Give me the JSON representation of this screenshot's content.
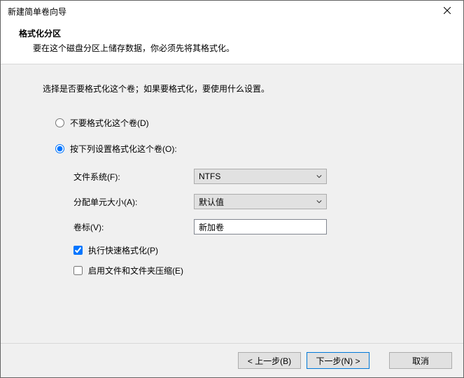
{
  "window": {
    "title": "新建简单卷向导"
  },
  "header": {
    "heading": "格式化分区",
    "description": "要在这个磁盘分区上储存数据，你必须先将其格式化。"
  },
  "body": {
    "instruction": "选择是否要格式化这个卷；如果要格式化，要使用什么设置。",
    "radio_noformat": "不要格式化这个卷(D)",
    "radio_format": "按下列设置格式化这个卷(O):",
    "fields": {
      "filesystem_label": "文件系统(F):",
      "filesystem_value": "NTFS",
      "allocation_label": "分配单元大小(A):",
      "allocation_value": "默认值",
      "volume_label": "卷标(V):",
      "volume_value": "新加卷"
    },
    "checks": {
      "quick_format": "执行快速格式化(P)",
      "compression": "启用文件和文件夹压缩(E)"
    }
  },
  "footer": {
    "back": "< 上一步(B)",
    "next": "下一步(N) >",
    "cancel": "取消"
  }
}
